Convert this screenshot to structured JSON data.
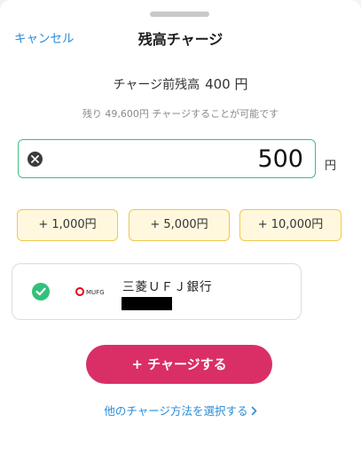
{
  "header": {
    "cancel_label": "キャンセル",
    "title": "残高チャージ"
  },
  "balance": {
    "label": "チャージ前残高",
    "amount": "400 円"
  },
  "remaining_note": "残り 49,600円 チャージすることが可能です",
  "amount_input": {
    "value": "500",
    "unit": "円"
  },
  "quick_amounts": [
    "+ 1,000円",
    "+ 5,000円",
    "+ 10,000円"
  ],
  "bank": {
    "logo_text": "MUFG",
    "name": "三菱ＵＦＪ銀行"
  },
  "charge_button_label": "+ チャージする",
  "other_method_link": "他のチャージ方法を選択する",
  "colors": {
    "link": "#2b8cd6",
    "input_border": "#39c27c",
    "quick_bg": "#fff8de",
    "quick_border": "#f1c64c",
    "primary": "#d92f66",
    "check": "#33c07b"
  },
  "icons": [
    "clear-icon",
    "check-circle-icon",
    "mufg-logo-icon",
    "chevron-right-icon"
  ]
}
